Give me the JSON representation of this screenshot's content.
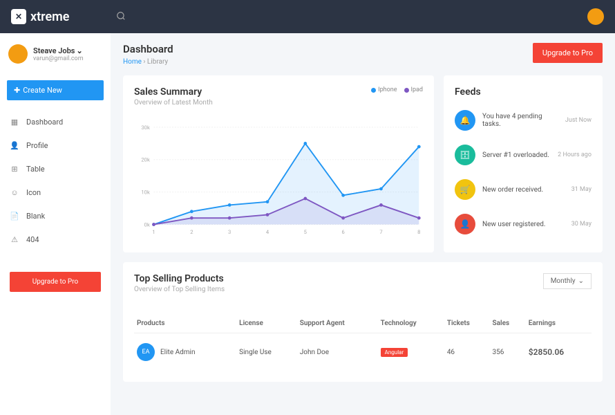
{
  "brand": "xtreme",
  "user": {
    "name": "Steave Jobs",
    "email": "varun@gmail.com"
  },
  "createBtn": "Create New",
  "nav": [
    {
      "label": "Dashboard",
      "icon": "▦"
    },
    {
      "label": "Profile",
      "icon": "👤"
    },
    {
      "label": "Table",
      "icon": "⊞"
    },
    {
      "label": "Icon",
      "icon": "☺"
    },
    {
      "label": "Blank",
      "icon": "📄"
    },
    {
      "label": "404",
      "icon": "⚠"
    }
  ],
  "upgradeBtn": "Upgrade to Pro",
  "page": {
    "title": "Dashboard",
    "crumbHome": "Home",
    "crumbCurrent": "Library"
  },
  "sales": {
    "title": "Sales Summary",
    "sub": "Overview of Latest Month",
    "legend": [
      {
        "name": "Iphone",
        "color": "#2196f3"
      },
      {
        "name": "Ipad",
        "color": "#7e57c2"
      }
    ]
  },
  "chart_data": {
    "type": "line",
    "x": [
      1,
      2,
      3,
      4,
      5,
      6,
      7,
      8
    ],
    "ylim": [
      0,
      30000
    ],
    "yticks": [
      "0k",
      "10k",
      "20k",
      "30k"
    ],
    "series": [
      {
        "name": "Iphone",
        "color": "#2196f3",
        "values": [
          0,
          4000,
          6000,
          7000,
          25000,
          9000,
          11000,
          24000
        ]
      },
      {
        "name": "Ipad",
        "color": "#7e57c2",
        "values": [
          0,
          2000,
          2000,
          3000,
          8000,
          2000,
          6000,
          2000
        ]
      }
    ]
  },
  "feeds": {
    "title": "Feeds",
    "items": [
      {
        "iconBg": "#2196f3",
        "icon": "🔔",
        "text": "You have 4 pending tasks.",
        "time": "Just Now"
      },
      {
        "iconBg": "#1abc9c",
        "icon": "🗄",
        "text": "Server #1 overloaded.",
        "time": "2 Hours ago"
      },
      {
        "iconBg": "#f1c40f",
        "icon": "🛒",
        "text": "New order received.",
        "time": "31 May"
      },
      {
        "iconBg": "#e74c3c",
        "icon": "👤",
        "text": "New user registered.",
        "time": "30 May"
      }
    ]
  },
  "products": {
    "title": "Top Selling Products",
    "sub": "Overview of Top Selling Items",
    "filter": "Monthly",
    "headers": [
      "Products",
      "License",
      "Support Agent",
      "Technology",
      "Tickets",
      "Sales",
      "Earnings"
    ],
    "rows": [
      {
        "initials": "EA",
        "name": "Elite Admin",
        "license": "Single Use",
        "agent": "John Doe",
        "tech": "Angular",
        "tickets": "46",
        "sales": "356",
        "earnings": "$2850.06"
      }
    ]
  }
}
